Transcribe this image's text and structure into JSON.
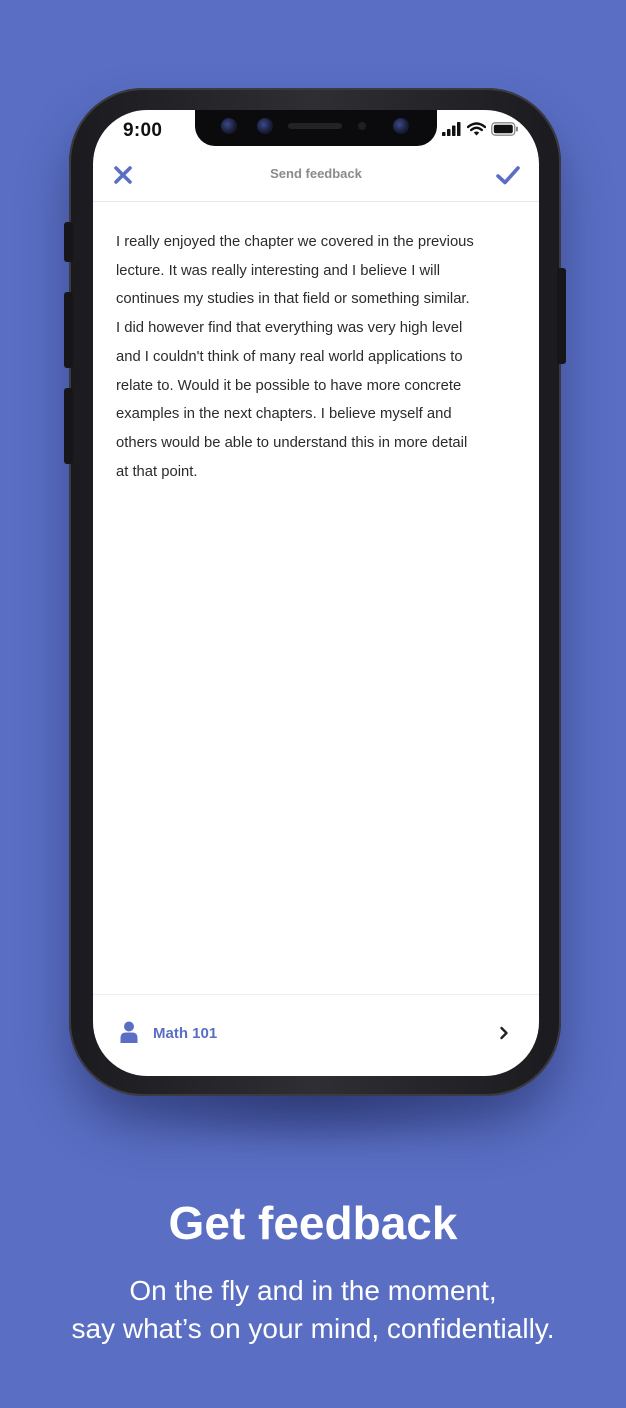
{
  "status_bar": {
    "time": "9:00"
  },
  "header": {
    "title": "Send feedback",
    "close_icon": "close-icon",
    "confirm_icon": "checkmark-icon"
  },
  "feedback": {
    "text": "I really enjoyed the chapter we covered in the previous\nlecture. It was really interesting and I believe I will\ncontinues my studies in that field or something similar.\nI did however find that everything was very high level\nand I couldn't think of many real world applications to\nrelate to. Would it be possible to have more concrete\nexamples in the next chapters. I believe myself and\nothers would be able to understand this in more detail\nat that point."
  },
  "footer": {
    "course": "Math 101",
    "person_icon": "person-icon",
    "chevron_icon": "chevron-right-icon"
  },
  "promo": {
    "headline": "Get feedback",
    "subline": "On the fly and in the moment,\nsay what’s on your mind, confidentially."
  },
  "colors": {
    "background": "#5a6fc4",
    "accent": "#5a6fc4"
  }
}
